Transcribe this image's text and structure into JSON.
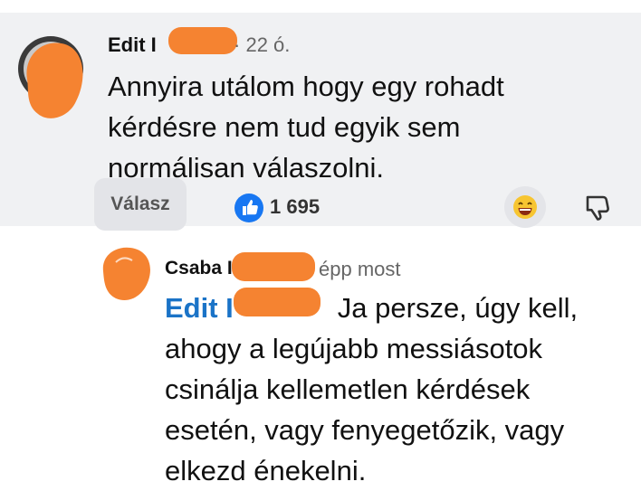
{
  "comment": {
    "author": "Edit I",
    "time": "22 ó.",
    "lines": [
      "Annyira utálom hogy egy rohadt",
      "kérdésre nem tud egyik sem",
      "normálisan válaszolni."
    ],
    "reply_label": "Válasz",
    "like_count": "1 695"
  },
  "reply": {
    "author": "Csaba I",
    "time": "épp most",
    "mention": "Edit I",
    "first_line_rest": "Ja persze, úgy kell,",
    "lines": [
      "ahogy a legújabb messiásotok",
      "csinálja kellemetlen kérdések",
      "esetén, vagy fenyegetőzik, vagy",
      "elkezd énekelni."
    ]
  },
  "colors": {
    "accent": "#1877f2",
    "redaction": "#f58331",
    "mention": "#1a73c7"
  }
}
